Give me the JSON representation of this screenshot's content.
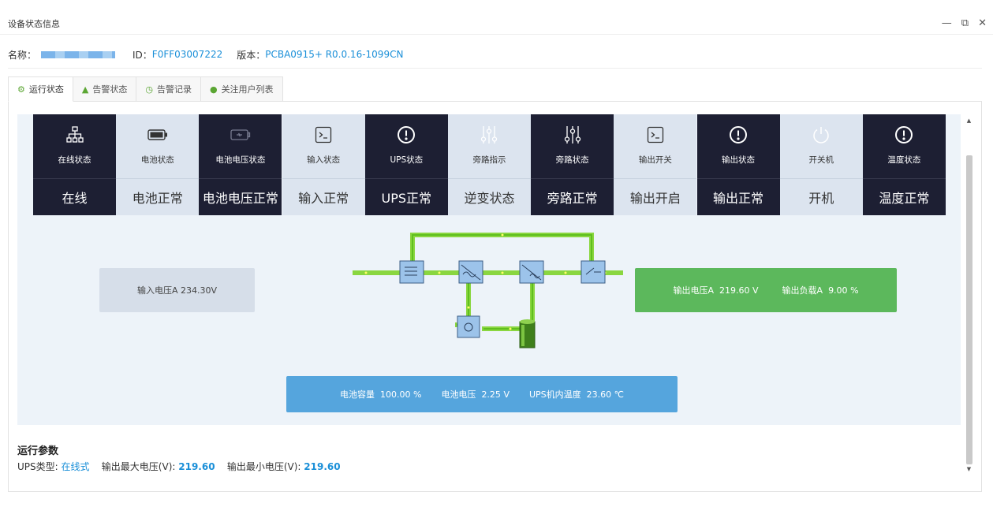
{
  "window": {
    "title": "设备状态信息",
    "controls": {
      "minimize": "—",
      "restore": "⧉",
      "close": "✕"
    }
  },
  "device": {
    "name_label": "名称：",
    "id_label": "ID：",
    "id_value": "F0FF03007222",
    "version_label": "版本：",
    "version_value": "PCBA0915+ R0.0.16-1099CN"
  },
  "tabs": [
    {
      "label": "运行状态",
      "icon": "gears-icon",
      "active": true
    },
    {
      "label": "告警状态",
      "icon": "warning-icon",
      "active": false
    },
    {
      "label": "告警记录",
      "icon": "clock-icon",
      "active": false
    },
    {
      "label": "关注用户列表",
      "icon": "wechat-icon",
      "active": false
    }
  ],
  "status_tiles": [
    {
      "caption": "在线状态",
      "value": "在线",
      "icon": "network-icon",
      "theme": "dark"
    },
    {
      "caption": "电池状态",
      "value": "电池正常",
      "icon": "battery-icon",
      "theme": "light"
    },
    {
      "caption": "电池电压状态",
      "value": "电池电压正常",
      "icon": "battery-charge-icon",
      "theme": "dark"
    },
    {
      "caption": "输入状态",
      "value": "输入正常",
      "icon": "terminal-icon",
      "theme": "light"
    },
    {
      "caption": "UPS状态",
      "value": "UPS正常",
      "icon": "alert-circle-icon",
      "theme": "dark"
    },
    {
      "caption": "旁路指示",
      "value": "逆变状态",
      "icon": "sliders-icon",
      "theme": "light"
    },
    {
      "caption": "旁路状态",
      "value": "旁路正常",
      "icon": "sliders-icon",
      "theme": "dark"
    },
    {
      "caption": "输出开关",
      "value": "输出开启",
      "icon": "terminal-icon",
      "theme": "light"
    },
    {
      "caption": "输出状态",
      "value": "输出正常",
      "icon": "alert-circle-icon",
      "theme": "dark"
    },
    {
      "caption": "开关机",
      "value": "开机",
      "icon": "power-icon",
      "theme": "light"
    },
    {
      "caption": "温度状态",
      "value": "温度正常",
      "icon": "alert-circle-icon",
      "theme": "dark"
    }
  ],
  "input_box": {
    "label": "输入电压A",
    "value": "234.30",
    "unit": "V"
  },
  "output_box": {
    "voltage_label": "输出电压A",
    "voltage_value": "219.60",
    "voltage_unit": "V",
    "load_label": "输出负载A",
    "load_value": "9.00",
    "load_unit": "%"
  },
  "battery_box": {
    "capacity_label": "电池容量",
    "capacity_value": "100.00",
    "capacity_unit": "%",
    "voltage_label": "电池电压",
    "voltage_value": "2.25",
    "voltage_unit": "V",
    "temp_label": "UPS机内温度",
    "temp_value": "23.60",
    "temp_unit": "℃"
  },
  "params": {
    "heading": "运行参数",
    "ups_type_label": "UPS类型:",
    "ups_type_value": "在线式",
    "max_label": "输出最大电压(V):",
    "max_value": "219.60",
    "min_label": "输出最小电压(V):",
    "min_value": "219.60"
  },
  "colors": {
    "dark_tile": "#1d1f33",
    "light_tile": "#dce4ef",
    "link_blue": "#1a8fd8",
    "output_green": "#5cb85c",
    "battery_blue": "#55a5dd",
    "flow_green": "#66cc22"
  }
}
